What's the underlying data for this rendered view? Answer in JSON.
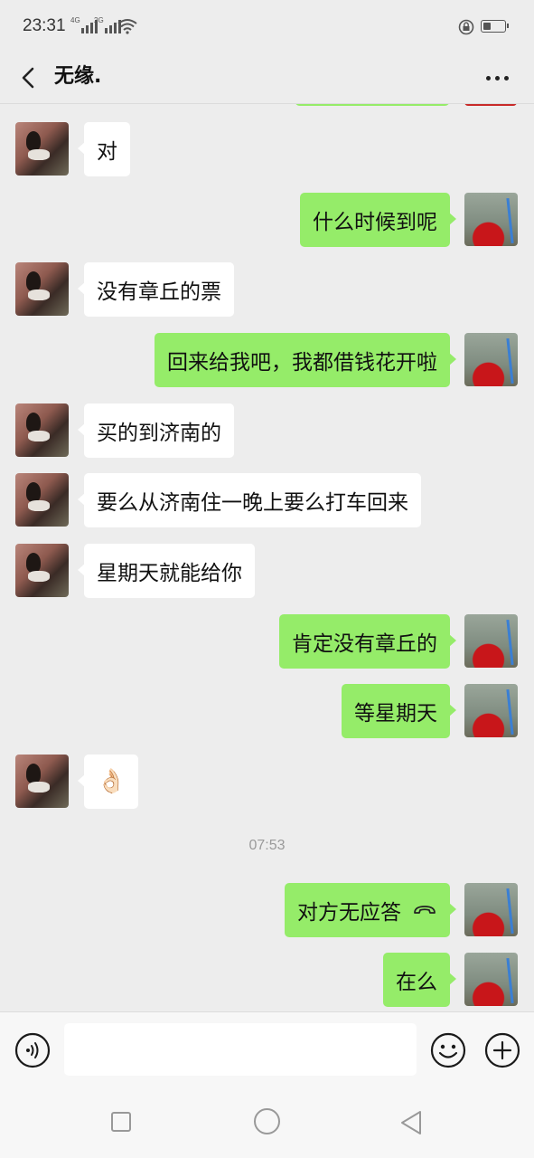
{
  "status_bar": {
    "time": "23:31",
    "signal1_label": "4G",
    "signal2_label": "2G",
    "battery_level": 0.35
  },
  "header": {
    "title": "无缘."
  },
  "messages": [
    {
      "side": "in",
      "text": "对"
    },
    {
      "side": "out",
      "text": "什么时候到呢"
    },
    {
      "side": "in",
      "text": "没有章丘的票"
    },
    {
      "side": "out",
      "text": "回来给我吧，我都借钱花开啦"
    },
    {
      "side": "in",
      "text": "买的到济南的"
    },
    {
      "side": "in",
      "text": "要么从济南住一晚上要么打车回来"
    },
    {
      "side": "in",
      "text": "星期天就能给你"
    },
    {
      "side": "out",
      "text": "肯定没有章丘的"
    },
    {
      "side": "out",
      "text": "等星期天"
    },
    {
      "side": "in",
      "text": "👌🏻"
    },
    {
      "side": "out",
      "text": "对方无应答",
      "icon": "call-declined-icon"
    },
    {
      "side": "out",
      "text": "在么"
    }
  ],
  "timestamp": "07:53",
  "input": {
    "value": "",
    "placeholder": ""
  },
  "colors": {
    "outgoing_bubble": "#95ec69",
    "incoming_bubble": "#ffffff",
    "background": "#ededed"
  }
}
